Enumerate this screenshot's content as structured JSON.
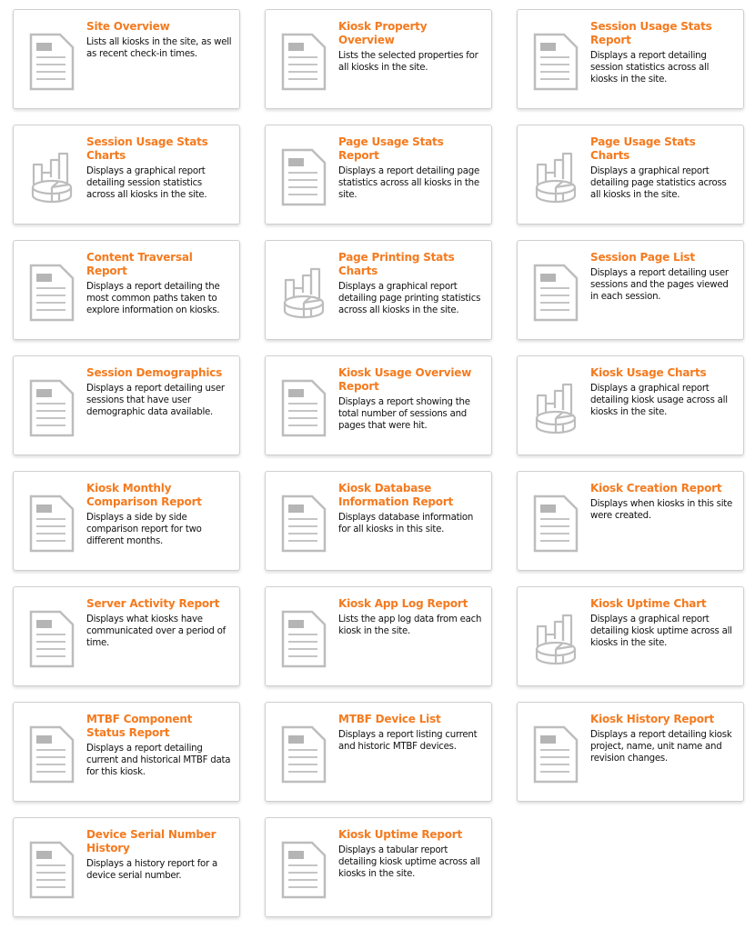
{
  "colors": {
    "title": "#f47b20",
    "icon": "#bdbdbd",
    "border": "#cfcfcf"
  },
  "reports": [
    {
      "title": "Site Overview",
      "description": "Lists all kiosks in the site, as well as recent check-in times.",
      "icon": "document-icon"
    },
    {
      "title": "Kiosk Property Overview",
      "description": "Lists the selected properties for all kiosks in the site.",
      "icon": "document-icon"
    },
    {
      "title": "Session Usage Stats Report",
      "description": "Displays a report detailing session statistics across all kiosks in the site.",
      "icon": "document-icon"
    },
    {
      "title": "Session Usage Stats Charts",
      "description": "Displays a graphical report detailing session statistics across all kiosks in the site.",
      "icon": "chart-icon"
    },
    {
      "title": "Page Usage Stats Report",
      "description": "Displays a report detailing page statistics across all kiosks in the site.",
      "icon": "document-icon"
    },
    {
      "title": "Page Usage Stats Charts",
      "description": "Displays a graphical report detailing page statistics across all kiosks in the site.",
      "icon": "chart-icon"
    },
    {
      "title": "Content Traversal Report",
      "description": "Displays a report detailing the most common paths taken to explore information on kiosks.",
      "icon": "document-icon"
    },
    {
      "title": "Page Printing Stats Charts",
      "description": "Displays a graphical report detailing page printing statistics across all kiosks in the site.",
      "icon": "chart-icon"
    },
    {
      "title": "Session Page List",
      "description": "Displays a report detailing user sessions and the pages viewed in each session.",
      "icon": "document-icon"
    },
    {
      "title": "Session Demographics",
      "description": "Displays a report detailing user sessions that have user demographic data available.",
      "icon": "document-icon"
    },
    {
      "title": "Kiosk Usage Overview Report",
      "description": "Displays a report showing the total number of sessions and pages that were hit.",
      "icon": "document-icon"
    },
    {
      "title": "Kiosk Usage Charts",
      "description": "Displays a graphical report detailing kiosk usage across all kiosks in the site.",
      "icon": "chart-icon"
    },
    {
      "title": "Kiosk Monthly Comparison Report",
      "description": "Displays a side by side comparison report for two different months.",
      "icon": "document-icon"
    },
    {
      "title": "Kiosk Database Information Report",
      "description": "Displays database information for all kiosks in this site.",
      "icon": "document-icon"
    },
    {
      "title": "Kiosk Creation Report",
      "description": "Displays when kiosks in this site were created.",
      "icon": "document-icon"
    },
    {
      "title": "Server Activity Report",
      "description": "Displays what kiosks have communicated over a period of time.",
      "icon": "document-icon"
    },
    {
      "title": "Kiosk App Log Report",
      "description": "Lists the app log data from each kiosk in the site.",
      "icon": "document-icon"
    },
    {
      "title": "Kiosk Uptime Chart",
      "description": "Displays a graphical report detailing kiosk uptime across all kiosks in the site.",
      "icon": "chart-icon"
    },
    {
      "title": "MTBF Component Status Report",
      "description": "Displays a report detailing current and historical MTBF data for this kiosk.",
      "icon": "document-icon"
    },
    {
      "title": "MTBF Device List",
      "description": "Displays a report listing current and historic MTBF devices.",
      "icon": "document-icon"
    },
    {
      "title": "Kiosk History Report",
      "description": "Displays a report detailing kiosk project, name, unit name and revision changes.",
      "icon": "document-icon"
    },
    {
      "title": "Device Serial Number History",
      "description": "Displays a history report for a device serial number.",
      "icon": "document-icon"
    },
    {
      "title": "Kiosk Uptime Report",
      "description": "Displays a tabular report detailing kiosk uptime across all kiosks in the site.",
      "icon": "document-icon"
    }
  ]
}
